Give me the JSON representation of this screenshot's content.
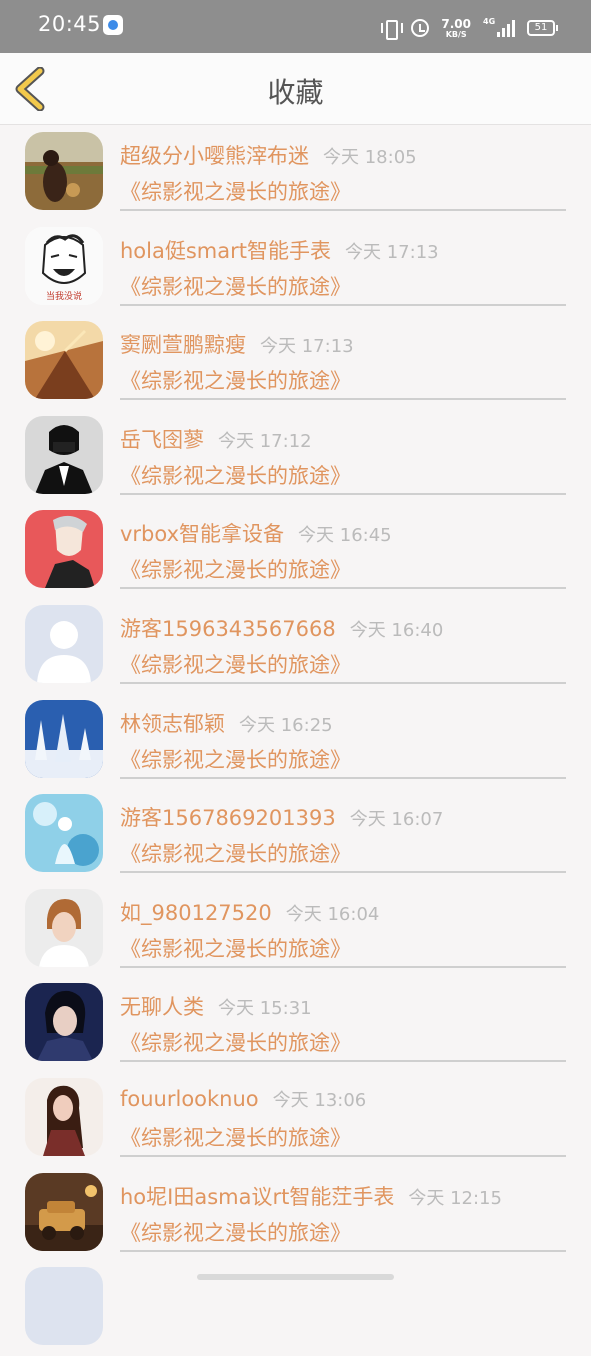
{
  "status_bar": {
    "time": "20:45",
    "net_speed_value": "7.00",
    "net_speed_unit": "KB/S",
    "network": "4G",
    "battery": "51"
  },
  "navbar": {
    "title": "收藏"
  },
  "favorites": [
    {
      "name": "超级分小嘤熊滓布迷",
      "time": "今天 18:05",
      "title": "《综影视之漫长的旅途》",
      "avatar_icon": "avatar-woman-field"
    },
    {
      "name": "hola侹smart智能手表",
      "time": "今天 17:13",
      "title": "《综影视之漫长的旅途》",
      "avatar_icon": "avatar-meme-face",
      "avatar_caption": "当我没说"
    },
    {
      "name": "窦劂萱鹏黥瘦",
      "time": "今天 17:13",
      "title": "《综影视之漫长的旅途》",
      "avatar_icon": "avatar-illustration"
    },
    {
      "name": "岳飞囹蓼",
      "time": "今天 17:12",
      "title": "《综影视之漫长的旅途》",
      "avatar_icon": "avatar-masked-man"
    },
    {
      "name": "vrbox智能拿设备",
      "time": "今天 16:45",
      "title": "《综影视之漫长的旅途》",
      "avatar_icon": "avatar-anime-boy"
    },
    {
      "name": "游客1596343567668",
      "time": "今天 16:40",
      "title": "《综影视之漫长的旅途》",
      "avatar_icon": "avatar-default-person"
    },
    {
      "name": "林领志郁颖",
      "time": "今天 16:25",
      "title": "《综影视之漫长的旅途》",
      "avatar_icon": "avatar-snow-trees"
    },
    {
      "name": "游客1567869201393",
      "time": "今天 16:07",
      "title": "《综影视之漫长的旅途》",
      "avatar_icon": "avatar-blue-fantasy"
    },
    {
      "name": "如_980127520",
      "time": "今天 16:04",
      "title": "《综影视之漫长的旅途》",
      "avatar_icon": "avatar-short-hair-woman"
    },
    {
      "name": "无聊人类",
      "time": "今天 15:31",
      "title": "《综影视之漫长的旅途》",
      "avatar_icon": "avatar-costume-man"
    },
    {
      "name": "fouurlooknuo",
      "time": "今天 13:06",
      "title": "《综影视之漫长的旅途》",
      "avatar_icon": "avatar-long-hair-woman"
    },
    {
      "name": "ho坭I田asma议rt智能茳手表",
      "time": "今天 12:15",
      "title": "《综影视之漫长的旅途》",
      "avatar_icon": "avatar-toy-car"
    }
  ],
  "colors": {
    "status_bar_bg": "#8e8e8e",
    "accent": "#e0955f",
    "back_arrow": "#f2c94c",
    "time_text": "#bbbbbb"
  }
}
